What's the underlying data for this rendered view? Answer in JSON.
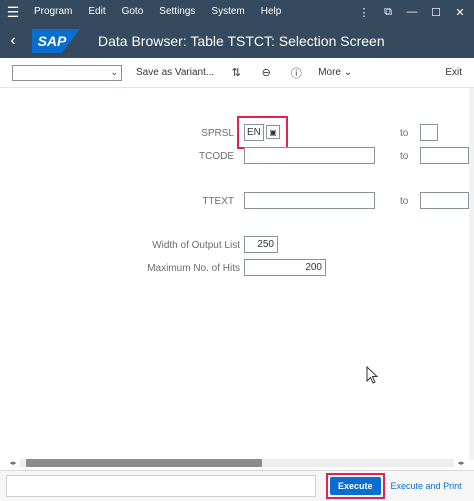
{
  "menubar": {
    "items": [
      "Program",
      "Edit",
      "Goto",
      "Settings",
      "System",
      "Help"
    ],
    "window_controls": [
      "⋮",
      "⧉",
      "—",
      "☐",
      "✕"
    ]
  },
  "titlebar": {
    "logo": "SAP",
    "title": "Data Browser: Table TSTCT: Selection Screen"
  },
  "toolbar": {
    "variant_value": "",
    "save_variant": "Save as Variant...",
    "more": "More ⌄",
    "exit": "Exit"
  },
  "selection": {
    "fields": [
      {
        "label": "SPRSL",
        "value": "EN"
      },
      {
        "label": "TCODE",
        "value": ""
      },
      {
        "label": "TTEXT",
        "value": ""
      }
    ],
    "to_label": "to",
    "width_label": "Width of Output List",
    "width_value": "250",
    "max_hits_label": "Maximum No. of Hits",
    "max_hits_value": "200"
  },
  "footer": {
    "execute": "Execute",
    "execute_and_print": "Execute and Print"
  },
  "colors": {
    "shell": "#354a5f",
    "accent": "#0a6ed1",
    "highlight": "#e0234f"
  }
}
